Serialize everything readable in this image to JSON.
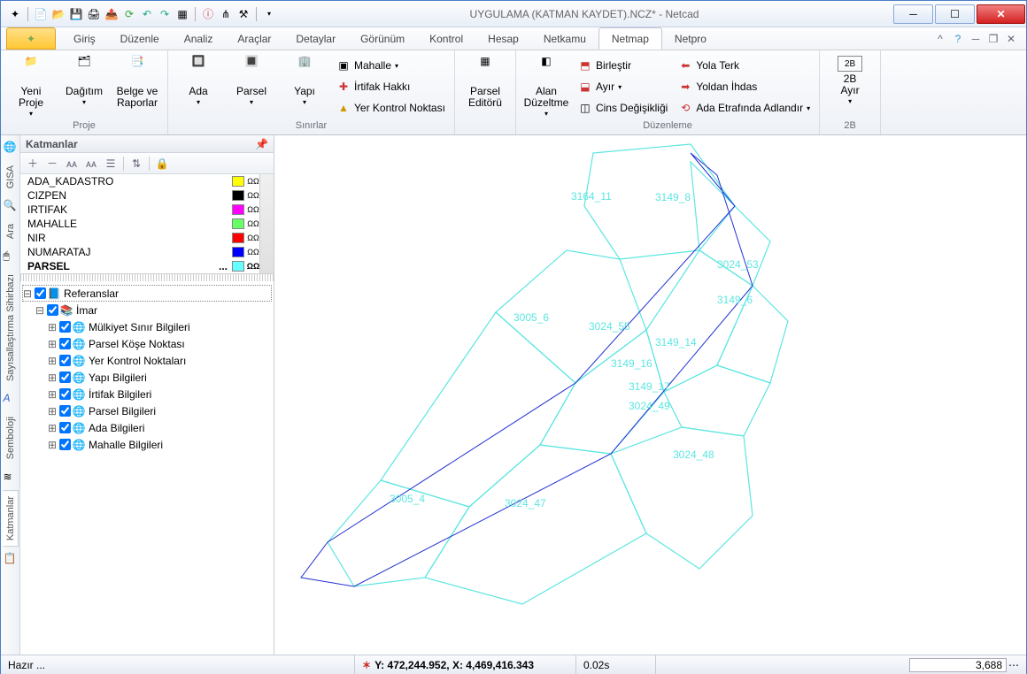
{
  "title": "UYGULAMA (KATMAN KAYDET).NCZ* - Netcad",
  "menu": {
    "tabs": [
      "Giriş",
      "Düzenle",
      "Analiz",
      "Araçlar",
      "Detaylar",
      "Görünüm",
      "Kontrol",
      "Hesap",
      "Netkamu",
      "Netmap",
      "Netpro"
    ],
    "active": "Netmap"
  },
  "ribbon": {
    "groups": {
      "proje": {
        "label": "Proje",
        "yeni_proje": "Yeni\nProje",
        "dagitim": "Dağıtım",
        "belge": "Belge ve\nRaporlar"
      },
      "sinirlar": {
        "label": "Sınırlar",
        "ada": "Ada",
        "parsel": "Parsel",
        "yapi": "Yapı",
        "mahalle": "Mahalle",
        "irtifak": "İrtifak Hakkı",
        "yer_kontrol": "Yer Kontrol Noktası"
      },
      "parsel_ed": "Parsel\nEditörü",
      "duzenleme": {
        "label": "Düzenleme",
        "alan": "Alan\nDüzeltme",
        "birlestir": "Birleştir",
        "ayir": "Ayır",
        "cins": "Cins Değişikliği",
        "yola_terk": "Yola Terk",
        "yoldan_ihdas": "Yoldan İhdas",
        "ada_etrafinda": "Ada Etrafında Adlandır"
      },
      "2b": {
        "label": "2B",
        "ayir": "2B\nAyır"
      }
    }
  },
  "panel": {
    "title": "Katmanlar",
    "layers": [
      {
        "name": "ADA_KADASTRO",
        "color": "#ffff00"
      },
      {
        "name": "CIZPEN",
        "color": "#000000"
      },
      {
        "name": "IRTIFAK",
        "color": "#ff00ff"
      },
      {
        "name": "MAHALLE",
        "color": "#66ff66"
      },
      {
        "name": "NIR",
        "color": "#ff0000"
      },
      {
        "name": "NUMARATAJ",
        "color": "#0000ff"
      },
      {
        "name": "PARSEL",
        "color": "#66ffff",
        "bold": true
      }
    ],
    "tree": {
      "root": "Referanslar",
      "imar": "İmar",
      "items": [
        "Mülkiyet Sınır Bilgileri",
        "Parsel Köşe Noktası",
        "Yer Kontrol Noktaları",
        "Yapı Bilgileri",
        "İrtifak Bilgileri",
        "Parsel Bilgileri",
        "Ada Bilgileri",
        "Mahalle Bilgileri"
      ]
    }
  },
  "side_tabs": [
    "GISA",
    "Ara",
    "Sayısallaştırma Sihirbazı",
    "Semboloji",
    "Katmanlar"
  ],
  "map_labels": [
    "3164_11",
    "3149_8",
    "3024_53",
    "3149_6",
    "3005_6",
    "3024_55",
    "3149_14",
    "3149_16",
    "3149_17",
    "3024_49",
    "3024_48",
    "3024_47",
    "3005_4"
  ],
  "status": {
    "ready": "Hazır ...",
    "coords_label": "Y:",
    "coords_y": "472,244.952,",
    "coords_x_label": "X:",
    "coords_x": "4,469,416.343",
    "time": "0.02s",
    "value": "3,688"
  }
}
